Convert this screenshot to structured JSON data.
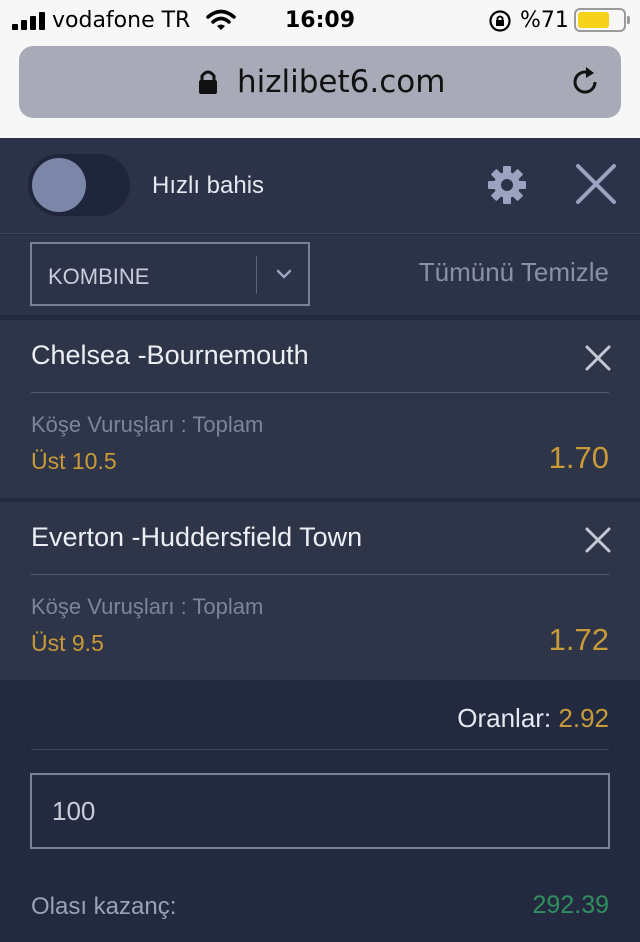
{
  "status_bar": {
    "carrier": "vodafone TR",
    "time": "16:09",
    "battery": "%71",
    "battery_level": 0.71,
    "icons": [
      "signal-icon",
      "wifi-icon",
      "rotation-lock-icon",
      "battery-icon"
    ]
  },
  "browser": {
    "url": "hizlibet6.com",
    "icons": [
      "lock-icon",
      "reload-icon"
    ]
  },
  "header": {
    "quick_bet_label": "Hızlı bahis",
    "icons": [
      "gear-icon",
      "close-icon"
    ]
  },
  "bet_type": {
    "selected": "KOMBINE",
    "clear_all": "Tümünü Temizle"
  },
  "bets": [
    {
      "match": "Chelsea -Bournemouth",
      "market": "Köşe Vuruşları : Toplam",
      "pick": "Üst 10.5",
      "odd": "1.70"
    },
    {
      "match": "Everton -Huddersfield Town",
      "market": "Köşe Vuruşları : Toplam",
      "pick": "Üst 9.5",
      "odd": "1.72"
    }
  ],
  "summary": {
    "odds_label": "Oranlar:",
    "odds_value": "2.92",
    "stake_value": "100",
    "potential_win_label": "Olası kazanç:",
    "potential_win_value": "292.39"
  },
  "colors": {
    "accent_odds": "#c99a38",
    "win_green": "#2f8f5e",
    "background": "#232a40",
    "panel": "#2e3548"
  }
}
